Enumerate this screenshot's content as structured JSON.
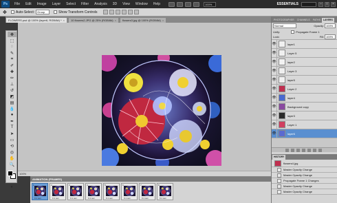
{
  "app": {
    "logo": "Ps",
    "menus": [
      "File",
      "Edit",
      "Image",
      "Layer",
      "Select",
      "Filter",
      "Analysis",
      "3D",
      "View",
      "Window",
      "Help"
    ],
    "zoom": "100%",
    "workspace": "ESSENTIALS"
  },
  "options": {
    "auto_select_label": "Auto-Select:",
    "auto_select_value": "Group",
    "show_transform_label": "Show Transform Controls"
  },
  "tabs": [
    {
      "label": "FLOWERS.psd @ 100% (layer6, RGB/8#) *",
      "active": true
    },
    {
      "label": "10 flowers2.JPG @ 25% (RGB/8#)",
      "active": false
    },
    {
      "label": "flowers3.jpg @ 100% (RGB/8#)",
      "active": false
    }
  ],
  "status": "100%",
  "animation": {
    "title": "ANIMATION (FRAMES)",
    "frames": [
      {
        "num": "1",
        "delay": "0.1 sec."
      },
      {
        "num": "2",
        "delay": "0.1 sec."
      },
      {
        "num": "3",
        "delay": "0.1 sec."
      },
      {
        "num": "4",
        "delay": "0.1 sec."
      },
      {
        "num": "5",
        "delay": "0.1 sec."
      },
      {
        "num": "6",
        "delay": "0.1 sec."
      },
      {
        "num": "7",
        "delay": "0.1 sec."
      },
      {
        "num": "8",
        "delay": "0.1 sec."
      }
    ]
  },
  "panels": {
    "tabs": [
      "PHOTOGRAPHER",
      "CHANNELS",
      "PATHS",
      "LAYERS"
    ],
    "blend_mode": "Normal",
    "opacity_label": "Opacity:",
    "opacity_value": "100%",
    "unify_label": "Unify:",
    "propagate_label": "Propagate Frame 1",
    "lock_label": "Lock:",
    "fill_label": "Fill:",
    "fill_value": "100%",
    "layers": [
      {
        "name": "layer1",
        "selected": false,
        "swatch": "#f0f0f0"
      },
      {
        "name": "Layer 5",
        "selected": false,
        "swatch": "#efefef"
      },
      {
        "name": "layer2",
        "selected": false,
        "swatch": "#f2f2f2"
      },
      {
        "name": "Layer 3",
        "selected": false,
        "swatch": "#eeeeee"
      },
      {
        "name": "layer5",
        "selected": false,
        "swatch": "#f1f1f1"
      },
      {
        "name": "Layer 2",
        "selected": false,
        "swatch": "#c03050"
      },
      {
        "name": "layer4",
        "selected": false,
        "swatch": "#4a6ad0"
      },
      {
        "name": "Background copy",
        "selected": false,
        "swatch": "#8a4aa0"
      },
      {
        "name": "layer3",
        "selected": false,
        "swatch": "#2a2a2a"
      },
      {
        "name": "Layer 1",
        "selected": false,
        "swatch": "#d04060"
      },
      {
        "name": "layer6",
        "selected": true,
        "swatch": "#5a6ad0"
      }
    ],
    "history_tab": "HISTORY",
    "history": [
      {
        "label": "flowers4.jpg",
        "snapshot": true
      },
      {
        "label": "Master Opacity Change",
        "snapshot": false
      },
      {
        "label": "Master Opacity Change",
        "snapshot": false
      },
      {
        "label": "Propagate Frame 1 Changes",
        "snapshot": false
      },
      {
        "label": "Master Opacity Change",
        "snapshot": false
      },
      {
        "label": "Master Opacity Change",
        "snapshot": false
      }
    ]
  },
  "colors": {
    "ui_dark": "#2b2b2b",
    "selection_blue": "#5a8fd0"
  }
}
